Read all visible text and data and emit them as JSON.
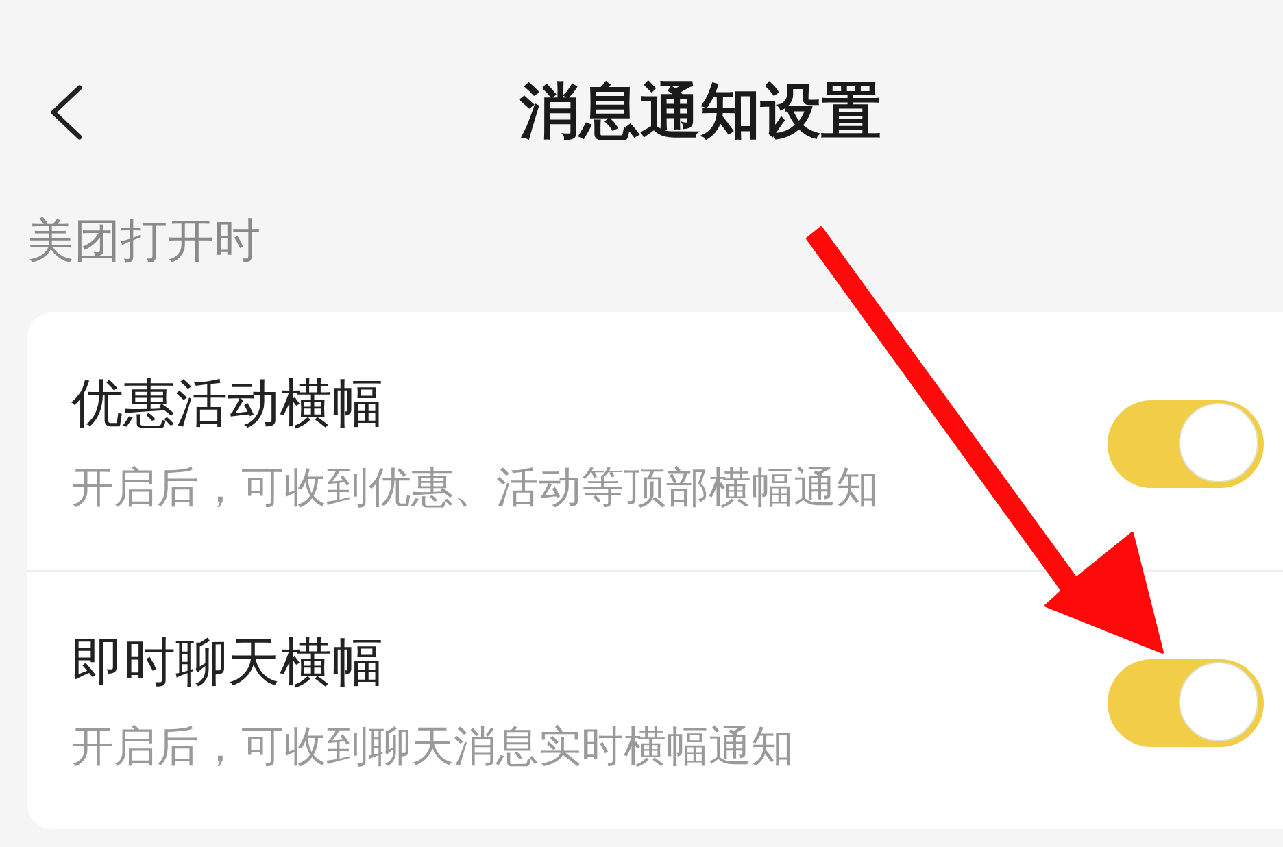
{
  "header": {
    "title": "消息通知设置"
  },
  "sections": [
    {
      "label": "美团打开时",
      "items": [
        {
          "title": "优惠活动横幅",
          "description": "开启后，可收到优惠、活动等顶部横幅通知",
          "on": true
        },
        {
          "title": "即时聊天横幅",
          "description": "开启后，可收到聊天消息实时横幅通知",
          "on": true
        }
      ]
    }
  ]
}
